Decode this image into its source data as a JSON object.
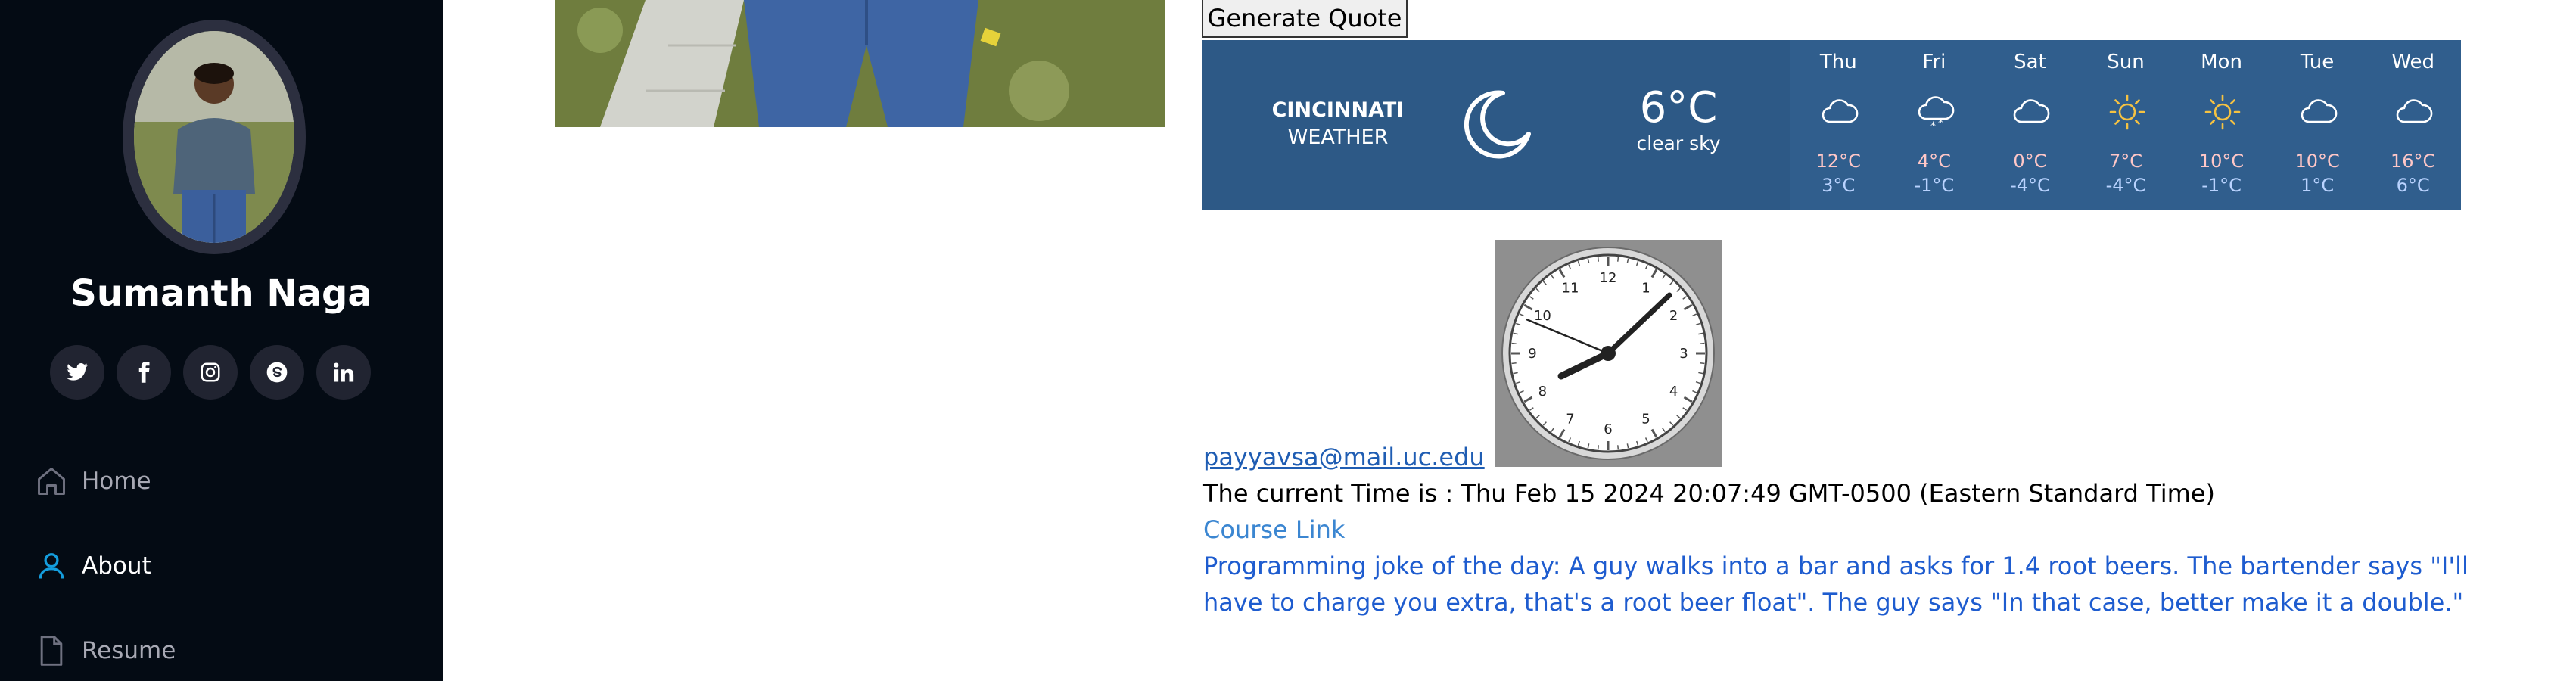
{
  "sidebar": {
    "name": "Sumanth Naga",
    "social_icons": [
      "twitter-icon",
      "facebook-icon",
      "instagram-icon",
      "skype-icon",
      "linkedin-icon"
    ],
    "nav": [
      {
        "label": "Home",
        "icon": "home-icon",
        "active": false
      },
      {
        "label": "About",
        "icon": "user-icon",
        "active": true
      },
      {
        "label": "Resume",
        "icon": "file-icon",
        "active": false
      }
    ]
  },
  "main": {
    "quote_button": "Generate Quote",
    "weather": {
      "city": "CINCINNATI",
      "label": "WEATHER",
      "current_temp": "6°C",
      "current_desc": "clear sky",
      "current_icon": "moon-icon",
      "forecast": [
        {
          "day": "Thu",
          "icon": "cloud-icon",
          "high": "12°C",
          "low": "3°C"
        },
        {
          "day": "Fri",
          "icon": "snow-cloud-icon",
          "high": "4°C",
          "low": "-1°C"
        },
        {
          "day": "Sat",
          "icon": "cloud-icon",
          "high": "0°C",
          "low": "-4°C"
        },
        {
          "day": "Sun",
          "icon": "sun-icon",
          "high": "7°C",
          "low": "-4°C"
        },
        {
          "day": "Mon",
          "icon": "sun-icon",
          "high": "10°C",
          "low": "-1°C"
        },
        {
          "day": "Tue",
          "icon": "cloud-icon",
          "high": "10°C",
          "low": "1°C"
        },
        {
          "day": "Wed",
          "icon": "cloud-icon",
          "high": "16°C",
          "low": "6°C"
        }
      ]
    },
    "clock": {
      "numbers": [
        "12",
        "1",
        "2",
        "3",
        "4",
        "5",
        "6",
        "7",
        "8",
        "9",
        "10",
        "11"
      ],
      "time": "20:07:49"
    },
    "email": "payyavsa@mail.uc.edu",
    "current_time": "The current Time is : Thu Feb 15 2024 20:07:49 GMT-0500 (Eastern Standard Time)",
    "course_link": "Course Link",
    "joke": "Programming joke of the day: A guy walks into a bar and asks for 1.4 root beers. The bartender says \"I'll have to charge you extra, that's a root beer float\". The guy says \"In that case, better make it a double.\""
  },
  "colors": {
    "sidebar_bg": "#040b14",
    "weather_bg": "#2d5986",
    "forecast_bg": "#305e8d",
    "link_blue": "#1e5ccf",
    "sun_yellow": "#f5c242"
  }
}
